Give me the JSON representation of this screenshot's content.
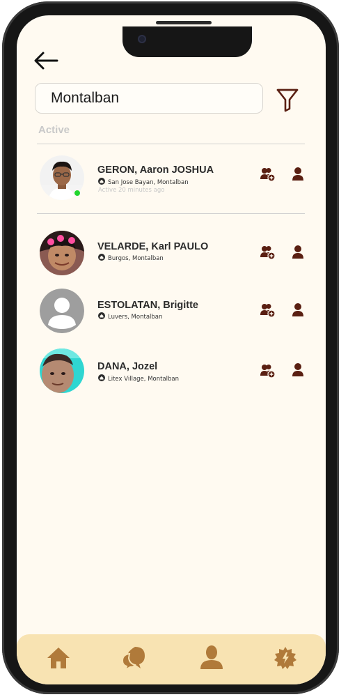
{
  "search": {
    "value": "Montalban",
    "placeholder": ""
  },
  "sections": {
    "active_label": "Active"
  },
  "friends": [
    {
      "name": "GERON, Aaron JOSHUA",
      "location": "San Jose Bayan, Montalban",
      "status": "Active 20 minutes ago",
      "online": true
    },
    {
      "name": "VELARDE, Karl PAULO",
      "location": "Burgos, Montalban"
    },
    {
      "name": "ESTOLATAN, Brigitte",
      "location": "Luvers, Montalban"
    },
    {
      "name": "DANA, Jozel",
      "location": "Litex Village, Montalban"
    }
  ],
  "icons": {
    "back": "arrow-left-icon",
    "filter": "filter-icon",
    "add_friend": "add-friend-icon",
    "profile": "person-icon",
    "location": "home-pin-icon",
    "nav": [
      "home-icon",
      "chat-icon",
      "profile-icon",
      "settings-icon"
    ]
  },
  "colors": {
    "screen_bg": "#fffaf1",
    "action_icon": "#5a1f12",
    "nav_bg": "#f8e3b2",
    "nav_icon": "#b07a3a",
    "online": "#22d62e",
    "section_label": "#c9c9c9"
  }
}
